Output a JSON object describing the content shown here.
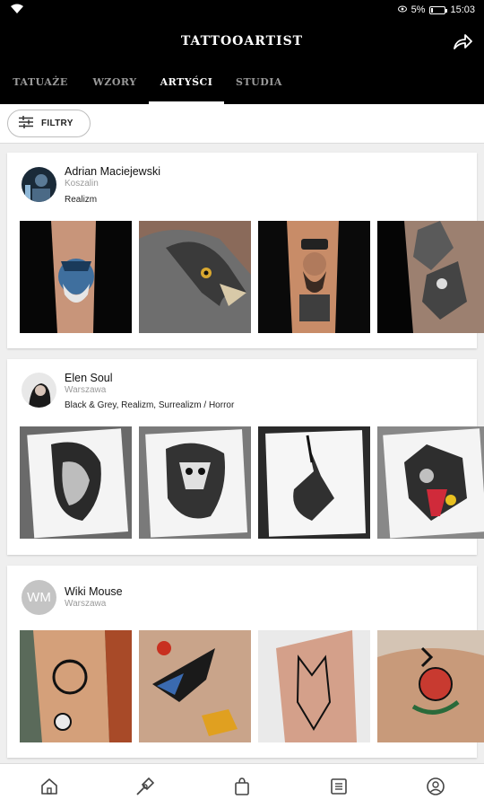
{
  "status": {
    "battery_percent": "5%",
    "time": "15:03"
  },
  "app": {
    "title": "TATTOOARTIST"
  },
  "tabs": [
    {
      "label": "TATUAŻE"
    },
    {
      "label": "WZORY"
    },
    {
      "label": "ARTYŚCI"
    },
    {
      "label": "STUDIA"
    }
  ],
  "active_tab": "ARTYŚCI",
  "filter": {
    "label": "FILTRY"
  },
  "artists": [
    {
      "name": "Adrian Maciejewski",
      "city": "Koszalin",
      "styles": "Realizm"
    },
    {
      "name": "Elen Soul",
      "city": "Warszawa",
      "styles": "Black & Grey, Realizm, Surrealizm / Horror"
    },
    {
      "name": "Wiki Mouse",
      "city": "Warszawa",
      "initials": "WM"
    }
  ],
  "bottom_nav": [
    "home-icon",
    "tattoo-machine-icon",
    "bag-icon",
    "list-icon",
    "profile-icon"
  ],
  "colors": {
    "bar_background": "#000000",
    "inactive_tab": "#9a9a9a",
    "active_tab": "#ffffff",
    "avatar_placeholder": "#c4c4c4"
  }
}
